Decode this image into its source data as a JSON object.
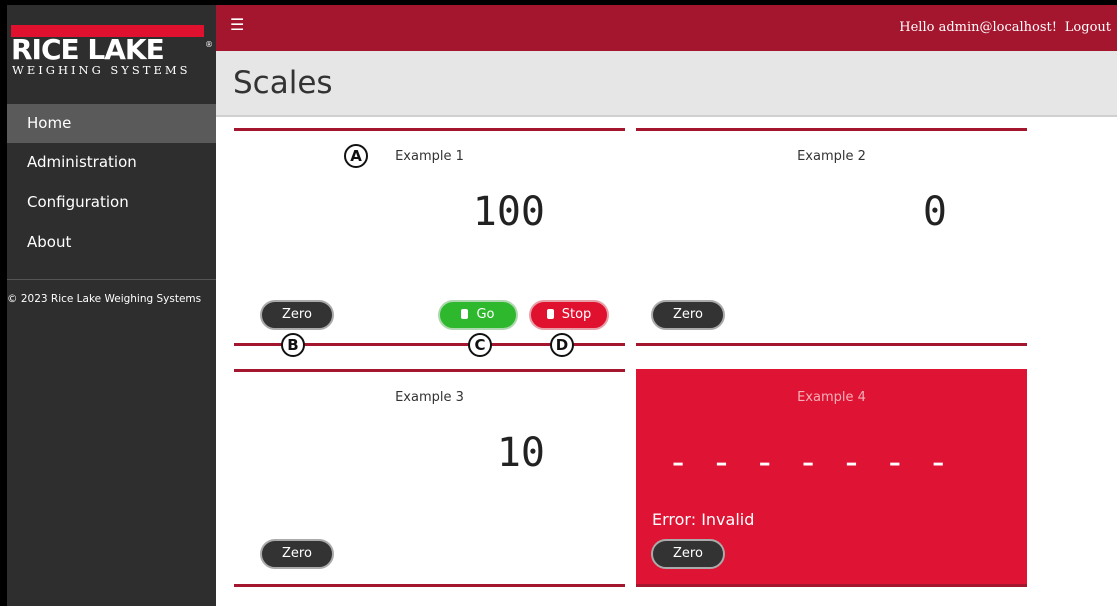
{
  "sidebar": {
    "logo": {
      "name": "RICE LAKE",
      "tagline": "WEIGHING SYSTEMS",
      "registered": "®"
    },
    "items": [
      {
        "label": "Home",
        "active": true
      },
      {
        "label": "Administration"
      },
      {
        "label": "Configuration"
      },
      {
        "label": "About"
      }
    ],
    "copyright": "© 2023 Rice Lake Weighing Systems"
  },
  "header": {
    "menu_icon": "☰",
    "greeting": "Hello admin@localhost!",
    "logout_label": "Logout"
  },
  "page": {
    "title": "Scales"
  },
  "scales": [
    {
      "name": "Example 1",
      "value": "100",
      "buttons": {
        "zero": "Zero",
        "go": "Go",
        "stop": "Stop"
      }
    },
    {
      "name": "Example 2",
      "value": "0",
      "buttons": {
        "zero": "Zero"
      }
    },
    {
      "name": "Example 3",
      "value": "10",
      "buttons": {
        "zero": "Zero"
      }
    },
    {
      "name": "Example 4",
      "value": "- - - - - - -",
      "error": "Error: Invalid",
      "buttons": {
        "zero": "Zero"
      }
    }
  ],
  "callouts": [
    "A",
    "B",
    "C",
    "D"
  ],
  "colors": {
    "brand": "#a4152e",
    "error": "#df1333",
    "go": "#2eb82e",
    "stop": "#e0102f",
    "sidebar": "#2e2e2e"
  }
}
